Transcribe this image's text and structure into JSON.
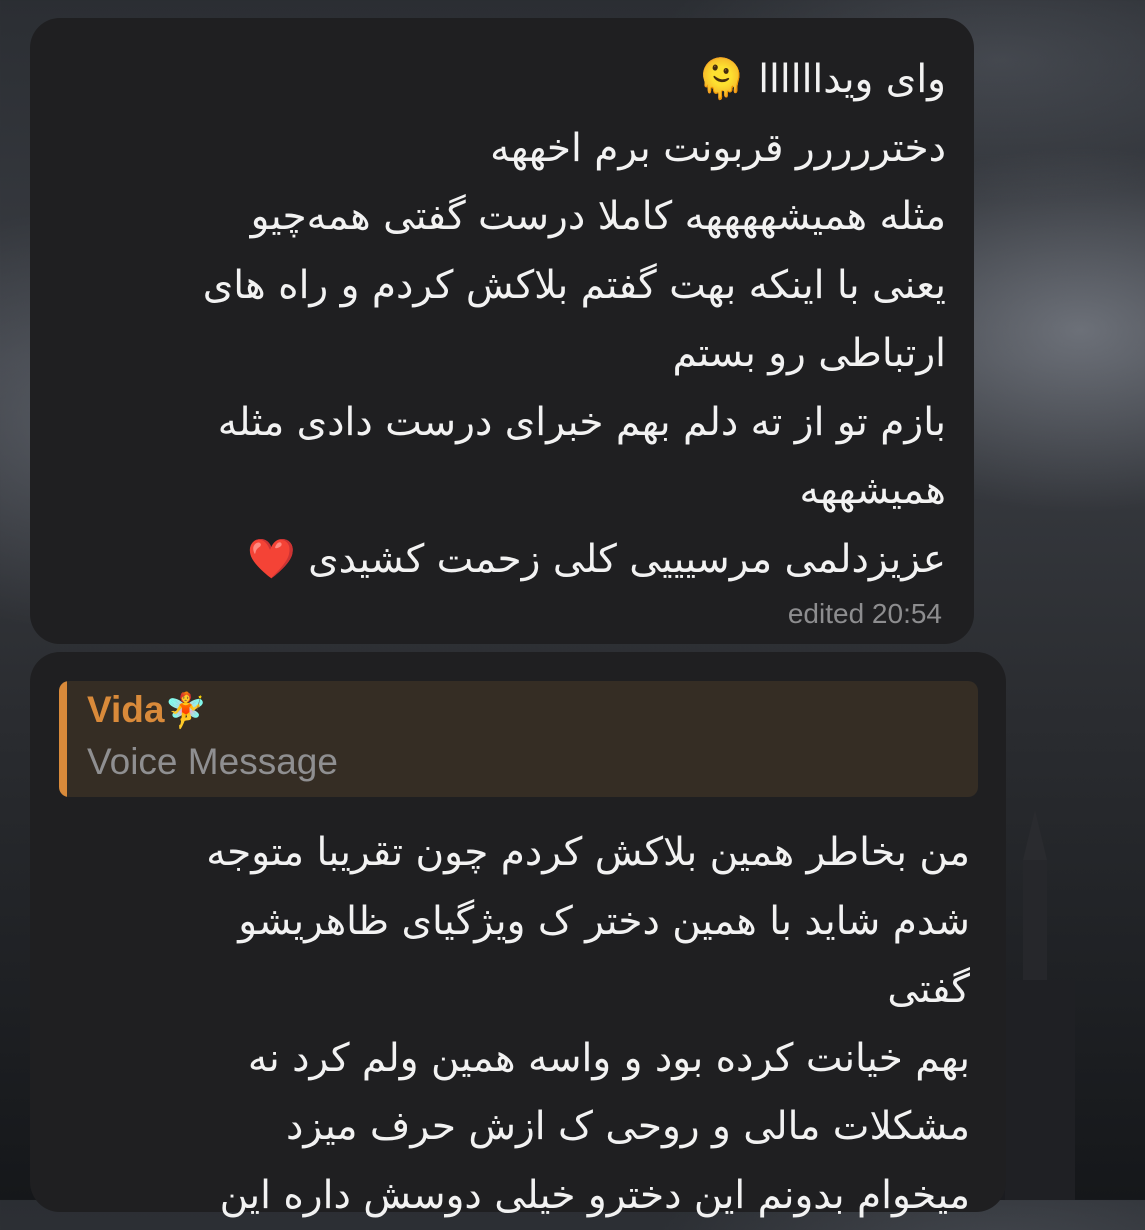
{
  "background_theme": "dark-castle-clouds",
  "messages": [
    {
      "lines": [
        "وای ویداااااا 🫠",
        "دختررررر قربونت برم اخههه",
        "مثله همیشههههه کاملا درست گفتی همه‌چیو",
        "یعنی با اینکه بهت گفتم بلاکش کردم و راه های",
        "ارتباطی رو بستم",
        "بازم تو از ته دلم بهم خبرای درست دادی مثله",
        "همیشههه",
        "عزیزدلمی مرسیییی کلی زحمت کشیدی ❤️"
      ],
      "status": "edited 20:54"
    },
    {
      "reply": {
        "name": "Vida",
        "name_emoji": "🧚",
        "preview": "Voice Message",
        "accent_color": "#d98a3a"
      },
      "lines": [
        "من بخاطر همین بلاکش کردم چون تقریبا متوجه",
        "شدم شاید با همین دختر ک ویژگیای ظاهریشو",
        "گفتی",
        "بهم خیانت کرده بود و واسه همین ولم کرد نه",
        "مشکلات مالی و روحی ک ازش حرف میزد",
        "میخوام بدونم این دخترو خیلی دوسش داره این"
      ]
    }
  ]
}
